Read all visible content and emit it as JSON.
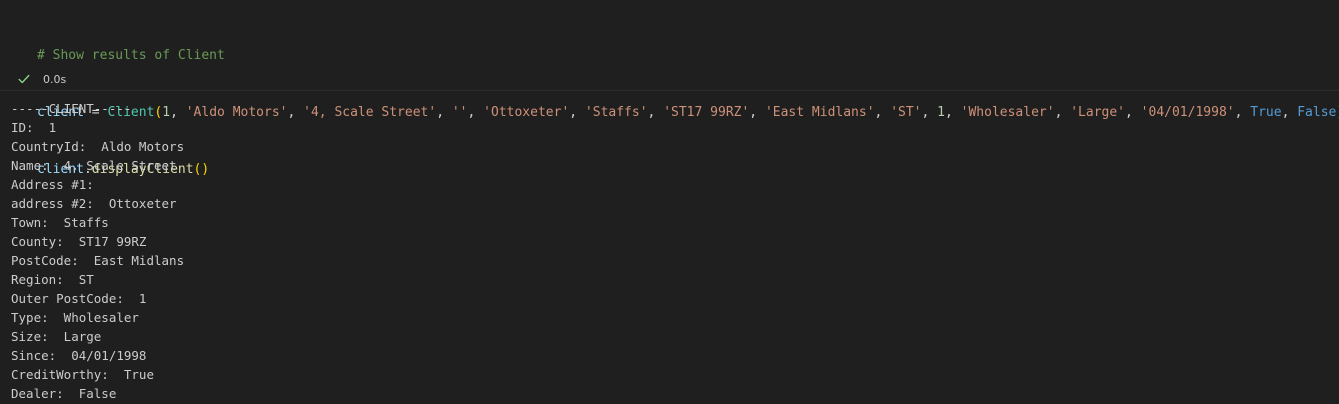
{
  "cell": {
    "comment": "# Show results of Client",
    "line2": {
      "var": "client",
      "eq": " = ",
      "class": "Client",
      "open": "(",
      "a1": "1",
      "sep1": ", ",
      "a2": "'Aldo Motors'",
      "sep2": ", ",
      "a3": "'4, Scale Street'",
      "sep3": ", ",
      "a4": "''",
      "sep4": ", ",
      "a5": "'Ottoxeter'",
      "sep5": ", ",
      "a6": "'Staffs'",
      "sep6": ", ",
      "a7": "'ST17 99RZ'",
      "sep7": ", ",
      "a8": "'East Midlans'",
      "sep8": ", ",
      "a9": "'ST'",
      "sep9": ", ",
      "a10": "1",
      "sep10": ", ",
      "a11": "'Wholesaler'",
      "sep11": ", ",
      "a12": "'Large'",
      "sep12": ", ",
      "a13": "'04/01/1998'",
      "sep13": ", ",
      "a14": "True",
      "sep14": ", ",
      "a15": "False",
      "close": ")"
    },
    "line3": {
      "var": "client",
      "dot": ".",
      "method": "displayClient",
      "parens": "()"
    },
    "status": {
      "time": "0.0s"
    }
  },
  "output": {
    "lines": [
      "-----CLIENT-----",
      "ID:  1",
      "CountryId:  Aldo Motors",
      "Name:  4, Scale Street",
      "Address #1:",
      "address #2:  Ottoxeter",
      "Town:  Staffs",
      "County:  ST17 99RZ",
      "PostCode:  East Midlans",
      "Region:  ST",
      "Outer PostCode:  1",
      "Type:  Wholesaler",
      "Size:  Large",
      "Since:  04/01/1998",
      "CreditWorthy:  True",
      "Dealer:  False"
    ]
  },
  "colors": {
    "background": "#1f1f1f",
    "success": "#89d185"
  },
  "icons": {
    "status": "check-icon"
  }
}
